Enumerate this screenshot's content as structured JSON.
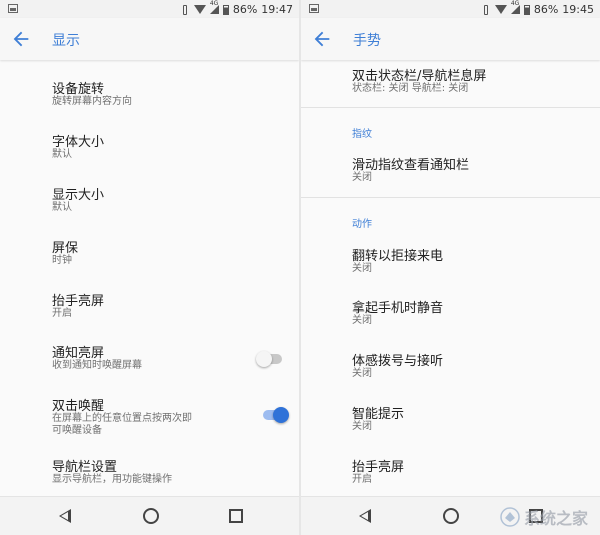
{
  "left": {
    "status": {
      "battery": "86%",
      "time": "19:47",
      "network": "4G"
    },
    "title": "显示",
    "items": [
      {
        "title": "设备旋转",
        "subtitle": "旋转屏幕内容方向"
      },
      {
        "title": "字体大小",
        "subtitle": "默认"
      },
      {
        "title": "显示大小",
        "subtitle": "默认"
      },
      {
        "title": "屏保",
        "subtitle": "时钟"
      },
      {
        "title": "抬手亮屏",
        "subtitle": "开启"
      },
      {
        "title": "通知亮屏",
        "subtitle": "收到通知时唤醒屏幕",
        "switch": false
      },
      {
        "title": "双击唤醒",
        "subtitle": "在屏幕上的任意位置点按两次即",
        "subtitle2": "可唤醒设备",
        "switch": true
      },
      {
        "title": "导航栏设置",
        "subtitle": "显示导航栏，用功能键操作"
      }
    ]
  },
  "right": {
    "status": {
      "battery": "86%",
      "time": "19:45",
      "network": "4G"
    },
    "title": "手势",
    "top_item": {
      "title": "双击状态栏/导航栏息屏",
      "subtitle": "状态栏: 关闭  导航栏: 关闭"
    },
    "section_fingerprint": "指纹",
    "fingerprint_item": {
      "title": "滑动指纹查看通知栏",
      "subtitle": "关闭"
    },
    "section_actions": "动作",
    "action_items": [
      {
        "title": "翻转以拒接来电",
        "subtitle": "关闭"
      },
      {
        "title": "拿起手机时静音",
        "subtitle": "关闭"
      },
      {
        "title": "体感拨号与接听",
        "subtitle": "关闭"
      },
      {
        "title": "智能提示",
        "subtitle": "关闭"
      },
      {
        "title": "抬手亮屏",
        "subtitle": "开启"
      }
    ]
  },
  "watermark": "系统之家",
  "colors": {
    "accent": "#3f7fd6",
    "switch_on": "#2f72d8"
  }
}
